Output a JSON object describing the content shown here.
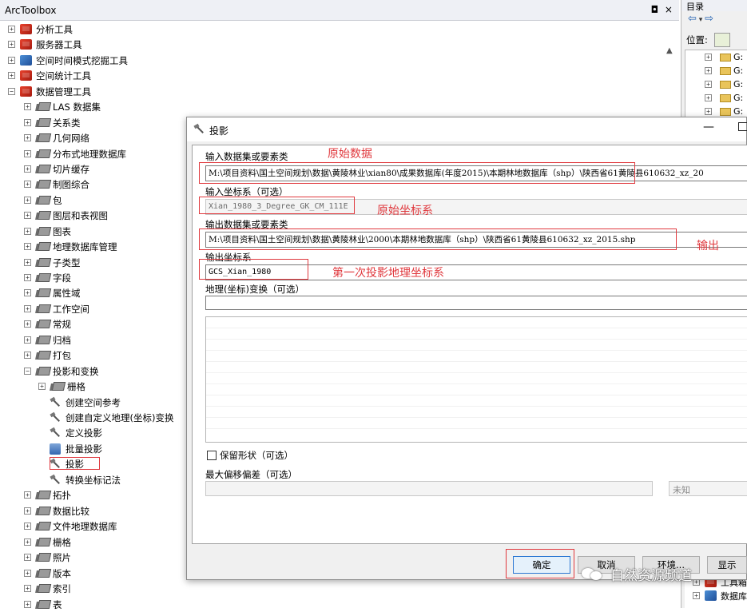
{
  "toolbox": {
    "title": "ArcToolbox",
    "title_buttons": "◘ ×",
    "items": [
      {
        "label": "分析工具"
      },
      {
        "label": "服务器工具"
      },
      {
        "label": "空间时间模式挖掘工具"
      },
      {
        "label": "空间统计工具"
      },
      {
        "label": "数据管理工具"
      },
      {
        "label": "LAS 数据集"
      },
      {
        "label": "关系类"
      },
      {
        "label": "几何网络"
      },
      {
        "label": "分布式地理数据库"
      },
      {
        "label": "切片缓存"
      },
      {
        "label": "制图综合"
      },
      {
        "label": "包"
      },
      {
        "label": "图层和表视图"
      },
      {
        "label": "图表"
      },
      {
        "label": "地理数据库管理"
      },
      {
        "label": "子类型"
      },
      {
        "label": "字段"
      },
      {
        "label": "属性域"
      },
      {
        "label": "工作空间"
      },
      {
        "label": "常规"
      },
      {
        "label": "归档"
      },
      {
        "label": "打包"
      },
      {
        "label": "投影和变换"
      },
      {
        "label": "栅格"
      },
      {
        "label": "创建空间参考"
      },
      {
        "label": "创建自定义地理(坐标)变换"
      },
      {
        "label": "定义投影"
      },
      {
        "label": "批量投影"
      },
      {
        "label": "投影"
      },
      {
        "label": "转换坐标记法"
      },
      {
        "label": "拓扑"
      },
      {
        "label": "数据比较"
      },
      {
        "label": "文件地理数据库"
      },
      {
        "label": "栅格"
      },
      {
        "label": "照片"
      },
      {
        "label": "版本"
      },
      {
        "label": "索引"
      },
      {
        "label": "表"
      }
    ]
  },
  "catalog": {
    "title": "目录",
    "location_label": "位置:",
    "tree_items": [
      "G:",
      "G:",
      "G:",
      "G:",
      "G:"
    ],
    "bottom_items": [
      "工具箱",
      "数据库"
    ]
  },
  "dialog": {
    "title": "投影",
    "in_dataset_label": "输入数据集或要素类",
    "in_dataset_value": "M:\\项目资料\\国土空间规划\\数据\\黄陵林业\\xian80\\成果数据库(年度2015)\\本期林地数据库（shp）\\陕西省61黄陵县610632_xz_20",
    "in_cs_label": "输入坐标系（可选）",
    "in_cs_value": "Xian_1980_3_Degree_GK_CM_111E",
    "out_dataset_label": "输出数据集或要素类",
    "out_dataset_value": "M:\\项目资料\\国土空间规划\\数据\\黄陵林业\\2000\\本期林地数据库（shp）\\陕西省61黄陵县610632_xz_2015.shp",
    "out_cs_label": "输出坐标系",
    "out_cs_value": "GCS_Xian_1980",
    "geo_transform_label": "地理(坐标)变换（可选）",
    "preserve_shape_label": "保留形状（可选）",
    "max_offset_label": "最大偏移偏差（可选）",
    "unit_value": "未知",
    "buttons": {
      "ok": "确定",
      "cancel": "取消",
      "env": "环境...",
      "show": "显示"
    }
  },
  "annotations": {
    "orig_data": "原始数据",
    "orig_cs": "原始坐标系",
    "output": "输出",
    "first_proj": "第一次投影地理坐标系"
  },
  "watermark": "自然资源频道",
  "colors": {
    "annotation": "#e0393e",
    "ok_border": "#2a76d2"
  }
}
